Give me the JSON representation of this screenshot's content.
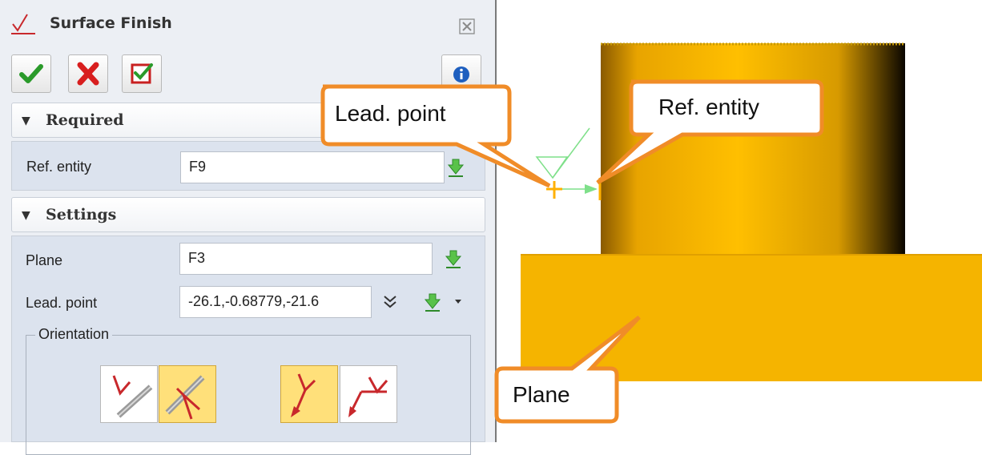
{
  "dialog": {
    "title": "Surface Finish",
    "toolbar": {
      "ok": "OK",
      "cancel": "Cancel",
      "apply": "Apply",
      "info": "Info"
    },
    "required": {
      "header": "Required",
      "ref_entity_label": "Ref. entity",
      "ref_entity_value": "F9"
    },
    "settings": {
      "header": "Settings",
      "plane_label": "Plane",
      "plane_value": "F3",
      "lead_point_label": "Lead. point",
      "lead_point_value": "-26.1,-0.68779,-21.6",
      "orientation_label": "Orientation",
      "orientation_group1_selected": 2,
      "orientation_group2_selected": 1
    }
  },
  "viewport": {
    "callouts": {
      "lead_point": "Lead. point",
      "ref_entity": "Ref. entity",
      "plane": "Plane"
    }
  },
  "colors": {
    "callout_border": "#f08c28",
    "part_yellow": "#f5b400",
    "selected_button": "#ffe07a",
    "panel_bg": "#eceff4",
    "section_bg": "#dce3ee"
  },
  "icons": [
    "surface-finish-icon",
    "close-icon",
    "check-icon",
    "cross-icon",
    "apply-icon",
    "info-icon",
    "pick-arrow-icon",
    "expand-chevron-icon",
    "dropdown-caret-icon"
  ]
}
